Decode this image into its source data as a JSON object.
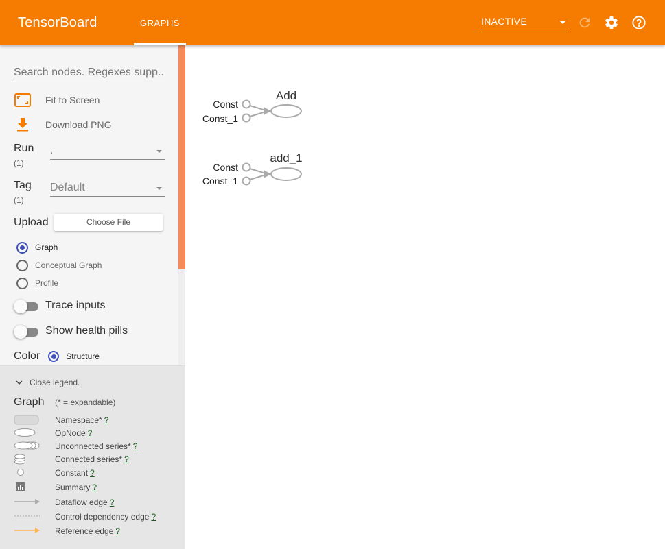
{
  "header": {
    "brand": "TensorBoard",
    "tab_label": "GRAPHS",
    "run_status": "INACTIVE",
    "brand_color": "#f57c00"
  },
  "sidebar": {
    "search_placeholder": "Search nodes. Regexes supp...",
    "fit_to_screen": "Fit to Screen",
    "download_png": "Download PNG",
    "run": {
      "label": "Run",
      "count": "(1)",
      "value": "."
    },
    "tag": {
      "label": "Tag",
      "count": "(1)",
      "value": "Default"
    },
    "upload": {
      "label": "Upload",
      "button": "Choose File"
    },
    "graph_types": [
      "Graph",
      "Conceptual Graph",
      "Profile"
    ],
    "selected_graph_type": "Graph",
    "trace_inputs": "Trace inputs",
    "show_health_pills": "Show health pills",
    "color": {
      "label": "Color",
      "option": "Structure"
    }
  },
  "legend": {
    "close_label": "Close legend.",
    "title": "Graph",
    "note": "(* = expandable)",
    "items": [
      {
        "label": "Namespace*",
        "help": "?",
        "icon": "namespace-icon"
      },
      {
        "label": "OpNode",
        "help": "?",
        "icon": "opnode-icon"
      },
      {
        "label": "Unconnected series*",
        "help": "?",
        "icon": "unconnected-series-icon"
      },
      {
        "label": "Connected series*",
        "help": "?",
        "icon": "connected-series-icon"
      },
      {
        "label": "Constant",
        "help": "?",
        "icon": "constant-icon"
      },
      {
        "label": "Summary",
        "help": "?",
        "icon": "summary-icon"
      },
      {
        "label": "Dataflow edge",
        "help": "?",
        "icon": "dataflow-edge-icon"
      },
      {
        "label": "Control dependency edge",
        "help": "?",
        "icon": "control-edge-icon"
      },
      {
        "label": "Reference edge",
        "help": "?",
        "icon": "reference-edge-icon"
      }
    ]
  },
  "graph": {
    "nodes": [
      {
        "name": "Add",
        "inputs": [
          "Const",
          "Const_1"
        ]
      },
      {
        "name": "add_1",
        "inputs": [
          "Const",
          "Const_1"
        ]
      }
    ]
  }
}
